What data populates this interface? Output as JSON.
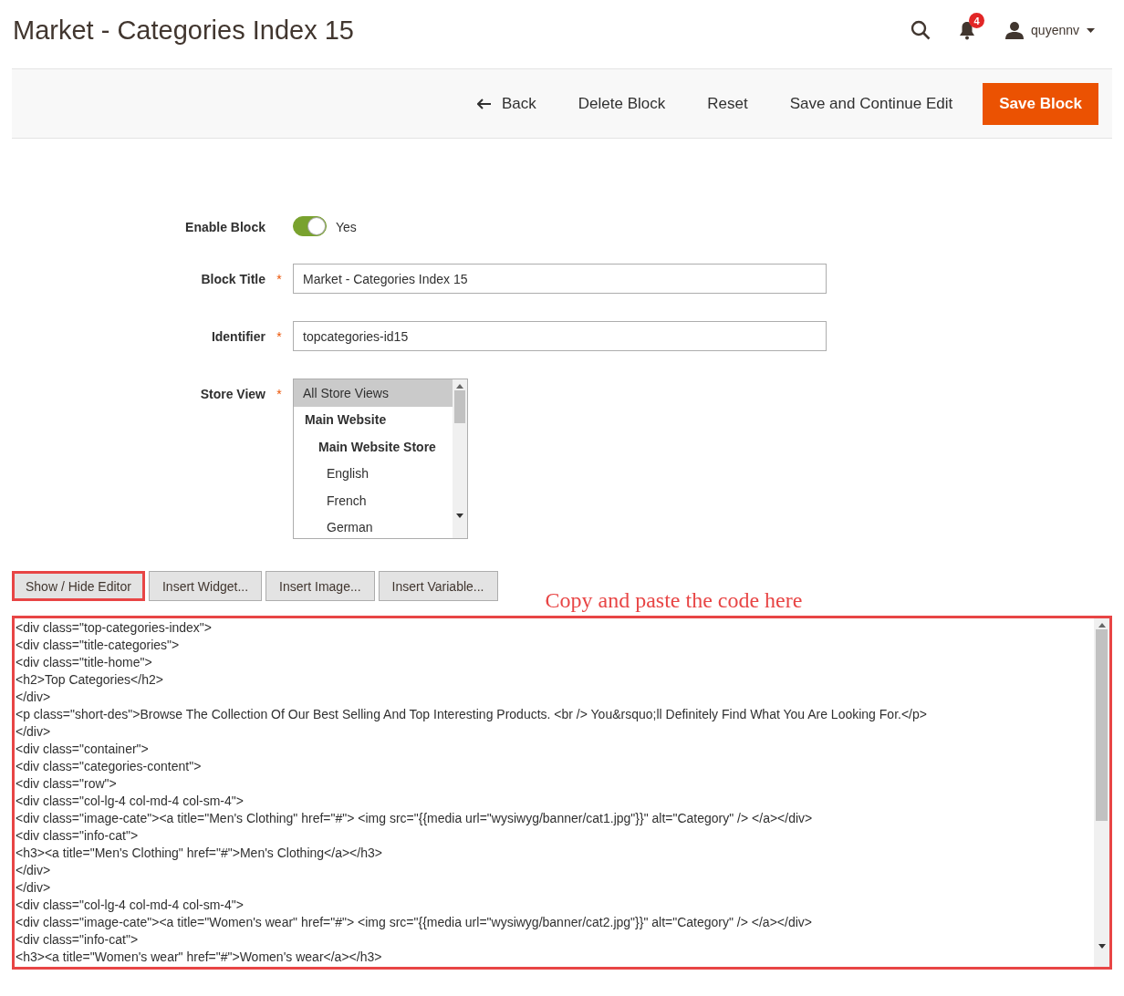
{
  "page_title": "Market - Categories Index 15",
  "header": {
    "notification_count": "4",
    "user_name": "quyennv"
  },
  "toolbar": {
    "buttons": [
      {
        "label": "Back",
        "kind": "back"
      },
      {
        "label": "Delete Block",
        "kind": "plain"
      },
      {
        "label": "Reset",
        "kind": "plain"
      },
      {
        "label": "Save and Continue Edit",
        "kind": "plain"
      },
      {
        "label": "Save Block",
        "kind": "primary"
      }
    ]
  },
  "form": {
    "enable_block": {
      "label": "Enable Block",
      "on": true,
      "value_label": "Yes"
    },
    "block_title": {
      "label": "Block Title",
      "required_mark": "*",
      "value": "Market - Categories Index 15"
    },
    "identifier": {
      "label": "Identifier",
      "required_mark": "*",
      "value": "topcategories-id15"
    },
    "store_view": {
      "label": "Store View",
      "required_mark": "*",
      "options": [
        {
          "label": "All Store Views",
          "kind": "all",
          "selected": true
        },
        {
          "label": "Main Website",
          "kind": "website",
          "selected": false
        },
        {
          "label": "Main Website Store",
          "kind": "store",
          "selected": false
        },
        {
          "label": "English",
          "kind": "view",
          "selected": false
        },
        {
          "label": "French",
          "kind": "view",
          "selected": false
        },
        {
          "label": "German",
          "kind": "view",
          "selected": false
        }
      ]
    }
  },
  "editor_buttons": [
    {
      "label": "Show / Hide Editor",
      "highlighted": true
    },
    {
      "label": "Insert Widget...",
      "highlighted": false
    },
    {
      "label": "Insert Image...",
      "highlighted": false
    },
    {
      "label": "Insert Variable...",
      "highlighted": false
    }
  ],
  "annotation": "Copy and paste the code here",
  "editor": {
    "highlighted": true,
    "lines": [
      "<div class=\"top-categories-index\">",
      "<div class=\"title-categories\">",
      "<div class=\"title-home\">",
      "<h2>Top Categories</h2>",
      "</div>",
      "<p class=\"short-des\">Browse The Collection Of Our Best Selling And Top Interesting Products. <br /> You&rsquo;ll Definitely Find What You Are Looking For.</p>",
      "</div>",
      "<div class=\"container\">",
      "<div class=\"categories-content\">",
      "<div class=\"row\">",
      "<div class=\"col-lg-4 col-md-4 col-sm-4\">",
      "<div class=\"image-cate\"><a title=\"Men's Clothing\" href=\"#\"> <img src=\"{{media url=\"wysiwyg/banner/cat1.jpg\"}}\" alt=\"Category\" /> </a></div>",
      "<div class=\"info-cat\">",
      "<h3><a title=\"Men's Clothing\" href=\"#\">Men's Clothing</a></h3>",
      "</div>",
      "</div>",
      "<div class=\"col-lg-4 col-md-4 col-sm-4\">",
      "<div class=\"image-cate\"><a title=\"Women's wear\" href=\"#\"> <img src=\"{{media url=\"wysiwyg/banner/cat2.jpg\"}}\" alt=\"Category\" /> </a></div>",
      "<div class=\"info-cat\">",
      "<h3><a title=\"Women's wear\" href=\"#\">Women's wear</a></h3>"
    ]
  }
}
